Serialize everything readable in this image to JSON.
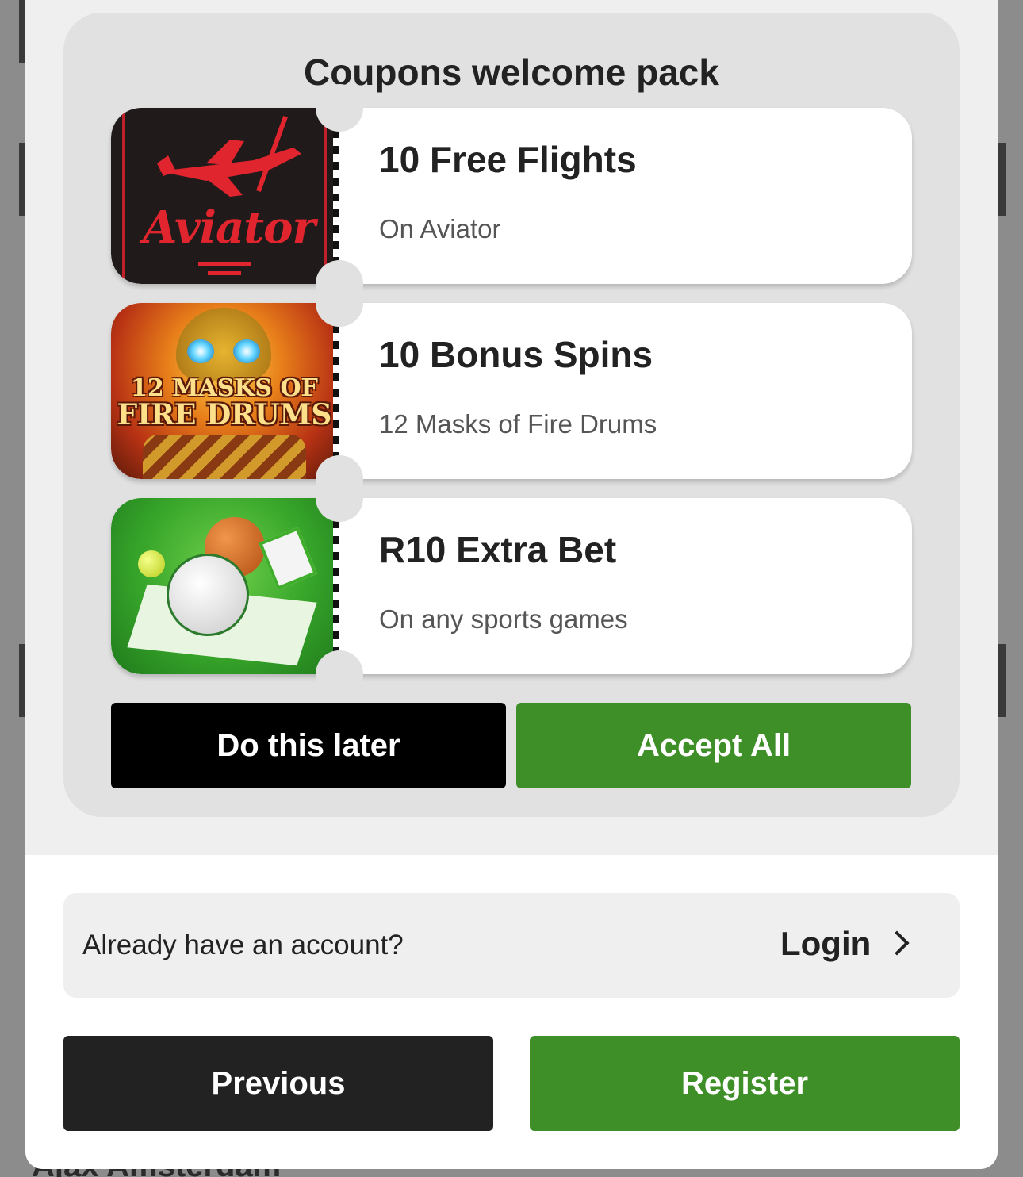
{
  "colors": {
    "accent_green": "#3e8f28",
    "black_button": "#000000",
    "dark_button": "#222222",
    "panel_bg": "#e1e1e1"
  },
  "coupons_panel": {
    "title": "Coupons welcome pack",
    "coupons": [
      {
        "title": "10 Free Flights",
        "subtitle": "On Aviator",
        "image": "aviator-game-icon",
        "image_text": "Aviator"
      },
      {
        "title": "10 Bonus Spins",
        "subtitle": "12 Masks of Fire Drums",
        "image": "masks-game-icon",
        "image_text_line1": "12 MASKS OF",
        "image_text_line2": "FIRE DRUMS"
      },
      {
        "title": "R10 Extra Bet",
        "subtitle": "On any sports games",
        "image": "sports-balls-icon"
      }
    ],
    "later_label": "Do this later",
    "accept_label": "Accept All"
  },
  "login_row": {
    "question": "Already have an account?",
    "link_label": "Login",
    "icon": "chevron-right-icon"
  },
  "footer": {
    "previous_label": "Previous",
    "register_label": "Register"
  },
  "background": {
    "partial_text": "Ajax Amsterdam"
  }
}
